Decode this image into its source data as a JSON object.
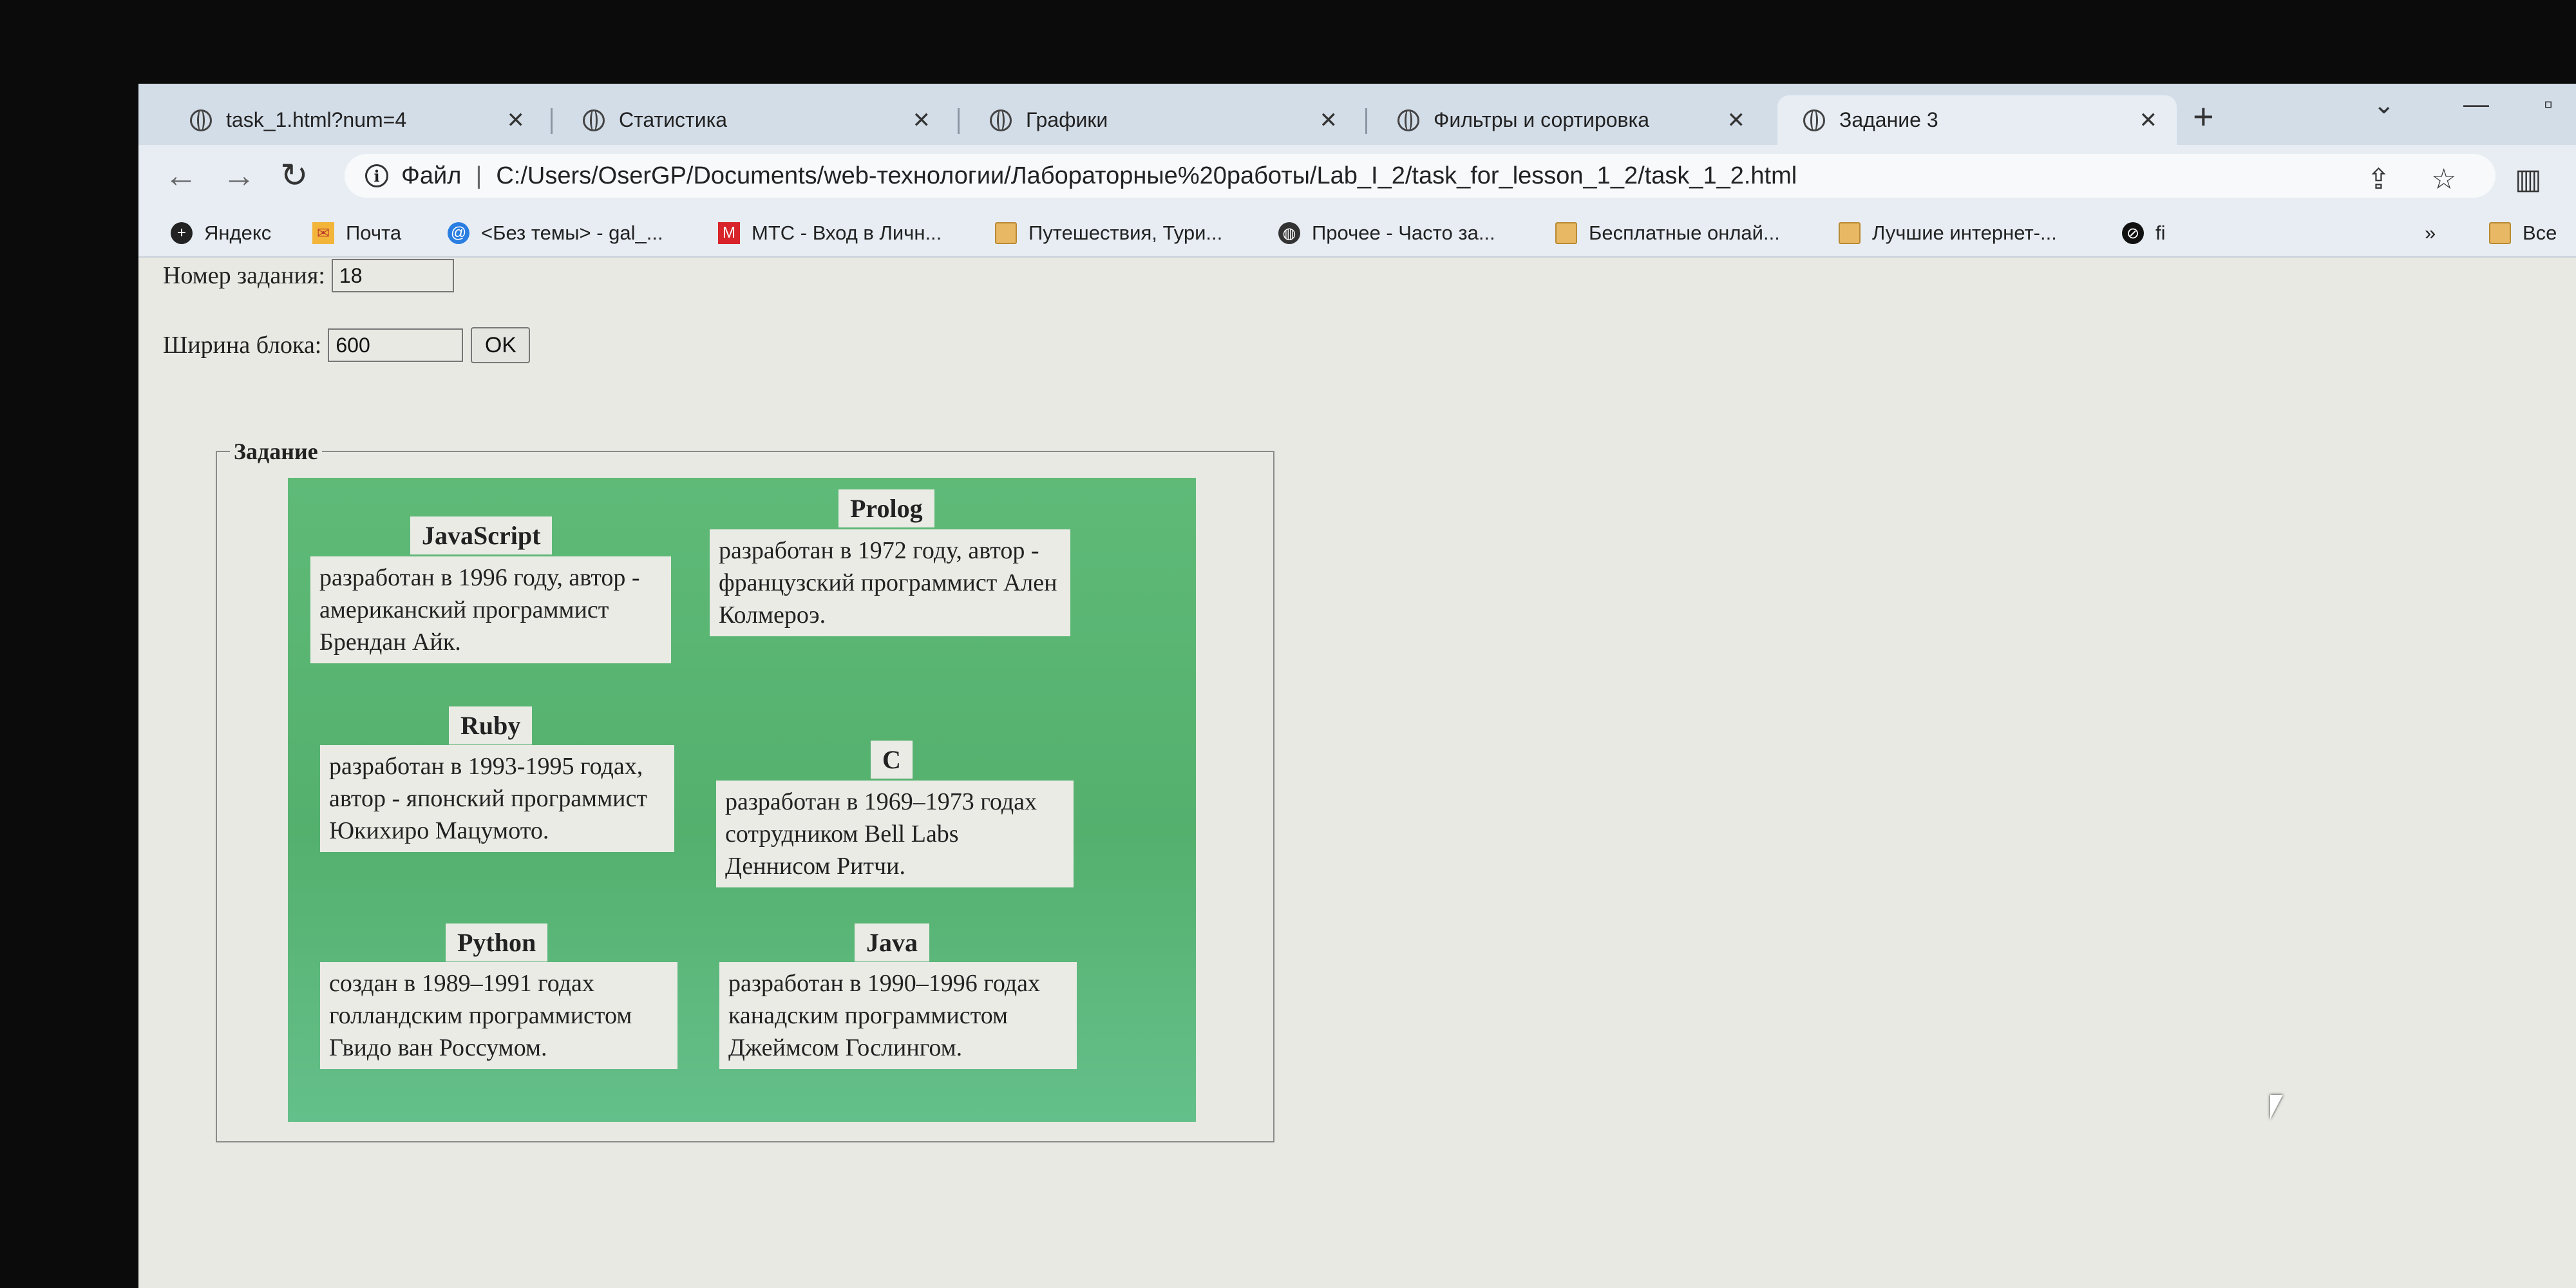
{
  "browser": {
    "tabs": [
      {
        "title": "task_1.html?num=4",
        "active": false
      },
      {
        "title": "Статистика",
        "active": false
      },
      {
        "title": "Графики",
        "active": false
      },
      {
        "title": "Фильтры и сортировка",
        "active": false
      },
      {
        "title": "Задание 3",
        "active": true
      }
    ],
    "address_bar": {
      "security_label": "Файл",
      "url": "C:/Users/OserGP/Documents/web-технологии/Лабораторные%20работы/Lab_I_2/task_for_lesson_1_2/task_1_2.html"
    },
    "bookmarks": [
      {
        "label": "Яндекс",
        "icon": "yandex-icon"
      },
      {
        "label": "Почта",
        "icon": "mail-icon"
      },
      {
        "label": "<Без темы> - gal_...",
        "icon": "at-icon"
      },
      {
        "label": "МТС - Вход в Личн...",
        "icon": "mts-icon"
      },
      {
        "label": "Путешествия, Тури...",
        "icon": "folder-icon"
      },
      {
        "label": "Прочее - Часто за...",
        "icon": "globe-icon"
      },
      {
        "label": "Бесплатные онлай...",
        "icon": "folder-icon"
      },
      {
        "label": "Лучшие интернет-...",
        "icon": "folder-icon"
      },
      {
        "label": "fi",
        "icon": "link-icon"
      }
    ],
    "bookmarks_more": "»",
    "all_bookmarks": "Все"
  },
  "page": {
    "task_number_label": "Номер задания:",
    "task_number_value": "18",
    "block_width_label": "Ширина блока:",
    "block_width_value": "600",
    "ok_label": "OK",
    "legend": "Задание",
    "languages": [
      {
        "name": "JavaScript",
        "description": "разработан в 1996 году, автор - американский программист Брендан Айк."
      },
      {
        "name": "Prolog",
        "description": "разработан в 1972 году, автор - французский программист Ален Колмероэ."
      },
      {
        "name": "Ruby",
        "description": "разработан в 1993-1995 годах, автор - японский программист Юкихиро Мацумото."
      },
      {
        "name": "C",
        "description": "разработан в 1969–1973 годах сотрудником Bell Labs Деннисом Ритчи."
      },
      {
        "name": "Python",
        "description": "создан в 1989–1991 годах голландским программистом Гвидо ван Россумом."
      },
      {
        "name": "Java",
        "description": "разработан в 1990–1996 годах канадским программистом Джеймсом Гослингом."
      }
    ]
  },
  "colors": {
    "block_green": "#5fba78",
    "card_bg": "#ebebe6",
    "page_bg": "#e9e9e3",
    "tabstrip_bg": "#d3dde8"
  }
}
